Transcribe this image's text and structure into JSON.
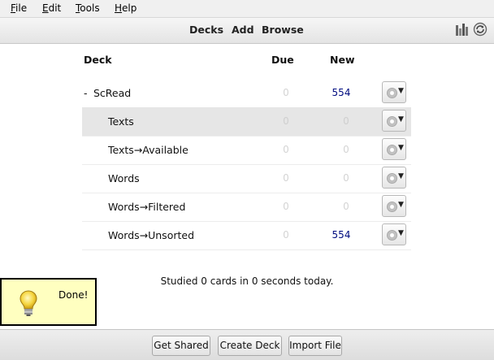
{
  "menu": {
    "file": "File",
    "edit": "Edit",
    "tools": "Tools",
    "help": "Help"
  },
  "toolbar": {
    "decks": "Decks",
    "add": "Add",
    "browse": "Browse",
    "icons": [
      "stats-icon",
      "sync-icon"
    ]
  },
  "decklist": {
    "headers": {
      "deck": "Deck",
      "due": "Due",
      "new": "New"
    },
    "rows": [
      {
        "collapse": "-",
        "name": "ScRead",
        "due": "0",
        "new": "554"
      },
      {
        "name": "Texts",
        "due": "0",
        "new": "0"
      },
      {
        "name": "Texts→Available",
        "due": "0",
        "new": "0"
      },
      {
        "name": "Words",
        "due": "0",
        "new": "0"
      },
      {
        "name": "Words→Filtered",
        "due": "0",
        "new": "0"
      },
      {
        "name": "Words→Unsorted",
        "due": "0",
        "new": "554"
      }
    ],
    "selected_row": "Texts",
    "studied": "Studied 0 cards in 0 seconds today."
  },
  "tooltip": {
    "text": "Done!",
    "icon": "lightbulb-icon"
  },
  "bottom": {
    "get_shared": "Get Shared",
    "create_deck": "Create Deck",
    "import_file": "Import File"
  },
  "colors": {
    "new_count": "#000c80",
    "zero_count": "#d4d4d4",
    "tooltip_bg": "#ffffc0",
    "selected_row": "#e6e6e6"
  }
}
